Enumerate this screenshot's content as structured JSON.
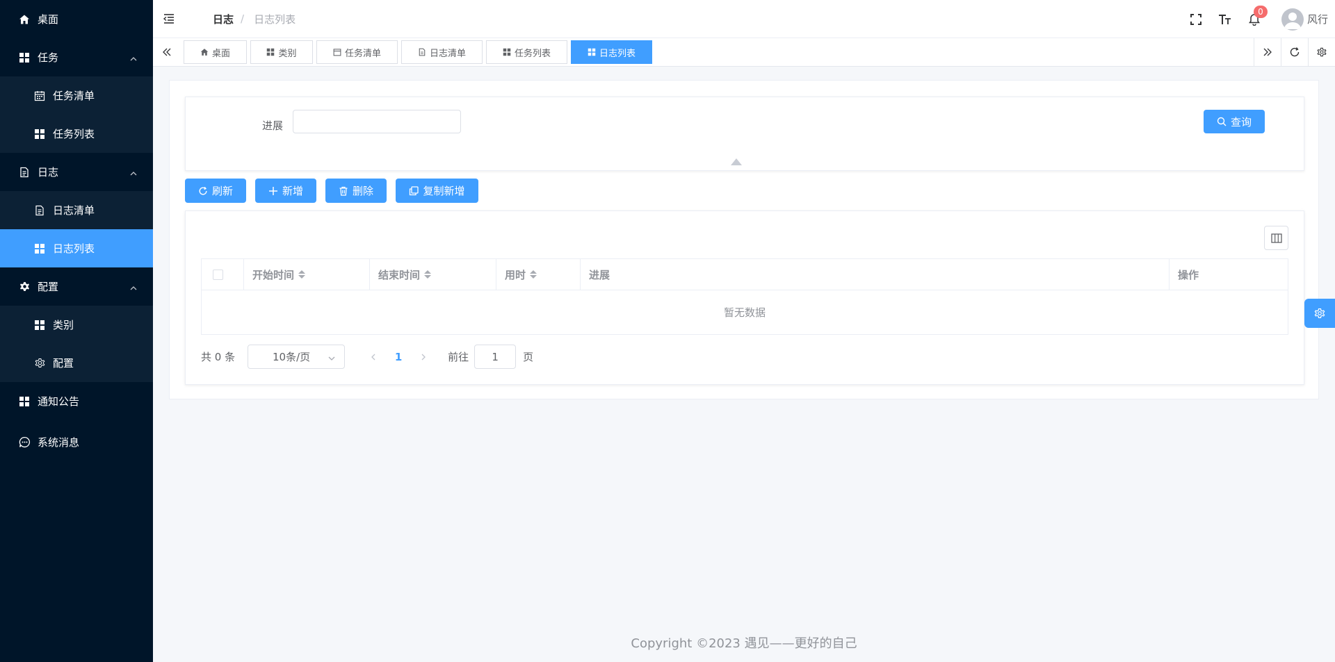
{
  "sidebar": {
    "desk": {
      "label": "桌面",
      "icon": "home-icon"
    },
    "tasks": {
      "label": "任务",
      "icon": "grid-icon",
      "children": [
        {
          "label": "任务清单",
          "icon": "calendar-icon"
        },
        {
          "label": "任务列表",
          "icon": "grid-icon"
        }
      ]
    },
    "logs": {
      "label": "日志",
      "icon": "document-icon",
      "children": [
        {
          "label": "日志清单",
          "icon": "document-icon"
        },
        {
          "label": "日志列表",
          "icon": "grid-icon"
        }
      ]
    },
    "config": {
      "label": "配置",
      "icon": "gear-icon",
      "children": [
        {
          "label": "类别",
          "icon": "grid-icon"
        },
        {
          "label": "配置",
          "icon": "gear-icon"
        }
      ]
    },
    "notice": {
      "label": "通知公告",
      "icon": "grid-icon"
    },
    "messages": {
      "label": "系统消息",
      "icon": "chat-icon"
    }
  },
  "header": {
    "breadcrumb": [
      "日志",
      "日志列表"
    ],
    "separator": "/",
    "notification_count": "0",
    "user_name": "风行"
  },
  "tabs": [
    {
      "label": "桌面",
      "icon": "home-icon"
    },
    {
      "label": "类别",
      "icon": "grid-icon"
    },
    {
      "label": "任务清单",
      "icon": "calendar-icon"
    },
    {
      "label": "日志清单",
      "icon": "document-icon"
    },
    {
      "label": "任务列表",
      "icon": "grid-icon"
    },
    {
      "label": "日志列表",
      "icon": "grid-icon",
      "active": true
    }
  ],
  "search": {
    "label": "进展",
    "value": "",
    "placeholder": "",
    "query_label": "查询"
  },
  "toolbar": {
    "refresh": "刷新",
    "add": "新增",
    "delete": "删除",
    "copy_add": "复制新增"
  },
  "table": {
    "columns": [
      "开始时间",
      "结束时间",
      "用时",
      "进展",
      "操作"
    ],
    "rows": [],
    "empty_text": "暂无数据"
  },
  "pagination": {
    "total_text": "共 0 条",
    "page_size": "10条/页",
    "current_page": "1",
    "goto_label": "前往",
    "goto_value": "1",
    "page_unit": "页"
  },
  "footer": {
    "copyright": "Copyright ©2023 遇见——更好的自己"
  },
  "colors": {
    "sidebar_bg": "#001529",
    "submenu_bg": "#0c2135",
    "primary": "#409eff",
    "badge": "#f56c6c"
  }
}
